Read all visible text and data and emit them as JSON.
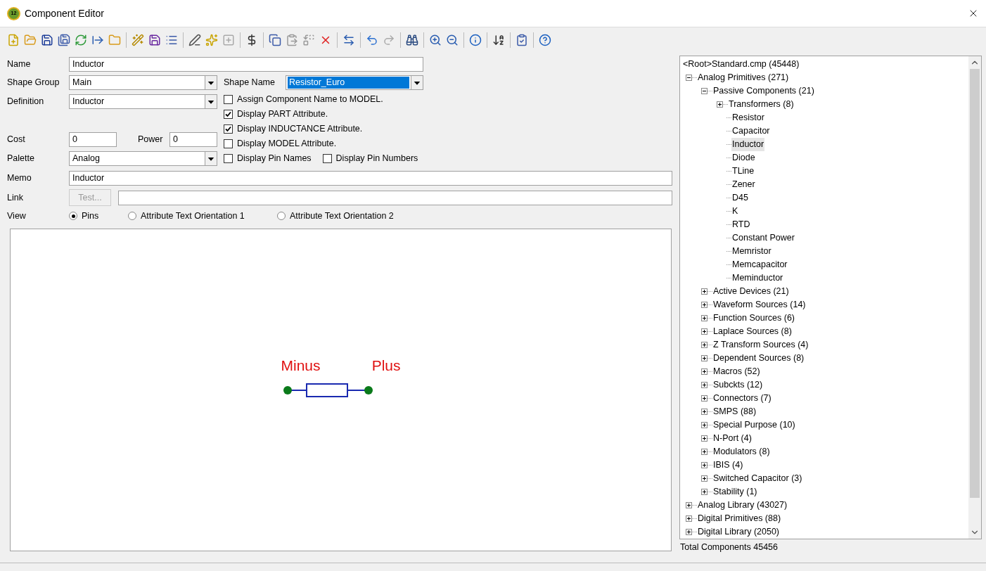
{
  "window": {
    "icon_text": "12",
    "title": "Component Editor"
  },
  "form": {
    "name": {
      "label": "Name",
      "value": "Inductor"
    },
    "shape_group": {
      "label": "Shape Group",
      "value": "Main"
    },
    "shape_name": {
      "label": "Shape Name",
      "value": "Resistor_Euro",
      "highlighted": true
    },
    "definition": {
      "label": "Definition",
      "value": "Inductor"
    },
    "cost": {
      "label": "Cost",
      "value": "0"
    },
    "power": {
      "label": "Power",
      "value": "0"
    },
    "palette": {
      "label": "Palette",
      "value": "Analog"
    },
    "memo": {
      "label": "Memo",
      "value": "Inductor"
    },
    "link": {
      "label": "Link",
      "button": "Test...",
      "button_disabled": true
    },
    "view": {
      "label": "View",
      "options": [
        {
          "label": "Pins",
          "selected": true
        },
        {
          "label": "Attribute Text Orientation 1",
          "selected": false
        },
        {
          "label": "Attribute Text Orientation 2",
          "selected": false
        }
      ]
    }
  },
  "display_options": [
    {
      "label": "Assign Component Name to MODEL.",
      "checked": false
    },
    {
      "label": "Display PART Attribute.",
      "checked": true
    },
    {
      "label": "Display INDUCTANCE Attribute.",
      "checked": true
    },
    {
      "label": "Display MODEL Attribute.",
      "checked": false
    },
    {
      "label": "Display Pin Names",
      "checked": false
    },
    {
      "label": "Display Pin Numbers",
      "checked": false
    }
  ],
  "preview": {
    "pins": [
      {
        "label": "Minus"
      },
      {
        "label": "Plus"
      }
    ]
  },
  "tree": {
    "label": "<Root>Standard.cmp (45448)",
    "children": [
      {
        "label": "Analog Primitives (271)",
        "expanded": true,
        "selected": false,
        "children": [
          {
            "label": "Passive Components (21)",
            "expanded": true,
            "selected": false,
            "children": [
              {
                "label": "Transformers (8)",
                "expanded": false,
                "selected": false
              },
              {
                "label": "Resistor",
                "selected": false
              },
              {
                "label": "Capacitor",
                "selected": false
              },
              {
                "label": "Inductor",
                "selected": true
              },
              {
                "label": "Diode",
                "selected": false
              },
              {
                "label": "TLine",
                "selected": false
              },
              {
                "label": "Zener",
                "selected": false
              },
              {
                "label": "D45",
                "selected": false
              },
              {
                "label": "K",
                "selected": false
              },
              {
                "label": "RTD",
                "selected": false
              },
              {
                "label": "Constant Power",
                "selected": false
              },
              {
                "label": "Memristor",
                "selected": false
              },
              {
                "label": "Memcapacitor",
                "selected": false
              },
              {
                "label": "Meminductor",
                "selected": false
              }
            ]
          },
          {
            "label": "Active Devices (21)",
            "expanded": false,
            "selected": false
          },
          {
            "label": "Waveform Sources (14)",
            "expanded": false,
            "selected": false
          },
          {
            "label": "Function Sources (6)",
            "expanded": false,
            "selected": false
          },
          {
            "label": "Laplace Sources (8)",
            "expanded": false,
            "selected": false
          },
          {
            "label": "Z Transform Sources (4)",
            "expanded": false,
            "selected": false
          },
          {
            "label": "Dependent Sources (8)",
            "expanded": false,
            "selected": false
          },
          {
            "label": "Macros (52)",
            "expanded": false,
            "selected": false
          },
          {
            "label": "Subckts (12)",
            "expanded": false,
            "selected": false
          },
          {
            "label": "Connectors (7)",
            "expanded": false,
            "selected": false
          },
          {
            "label": "SMPS (88)",
            "expanded": false,
            "selected": false
          },
          {
            "label": "Special Purpose (10)",
            "expanded": false,
            "selected": false
          },
          {
            "label": "N-Port (4)",
            "expanded": false,
            "selected": false
          },
          {
            "label": "Modulators (8)",
            "expanded": false,
            "selected": false
          },
          {
            "label": "IBIS (4)",
            "expanded": false,
            "selected": false
          },
          {
            "label": "Switched Capacitor (3)",
            "expanded": false,
            "selected": false
          },
          {
            "label": "Stability (1)",
            "expanded": false,
            "selected": false
          }
        ]
      },
      {
        "label": "Analog Library (43027)",
        "expanded": false,
        "selected": false
      },
      {
        "label": "Digital Primitives (88)",
        "expanded": false,
        "selected": false
      },
      {
        "label": "Digital Library (2050)",
        "expanded": false,
        "selected": false
      }
    ]
  },
  "total": "Total Components 45456"
}
